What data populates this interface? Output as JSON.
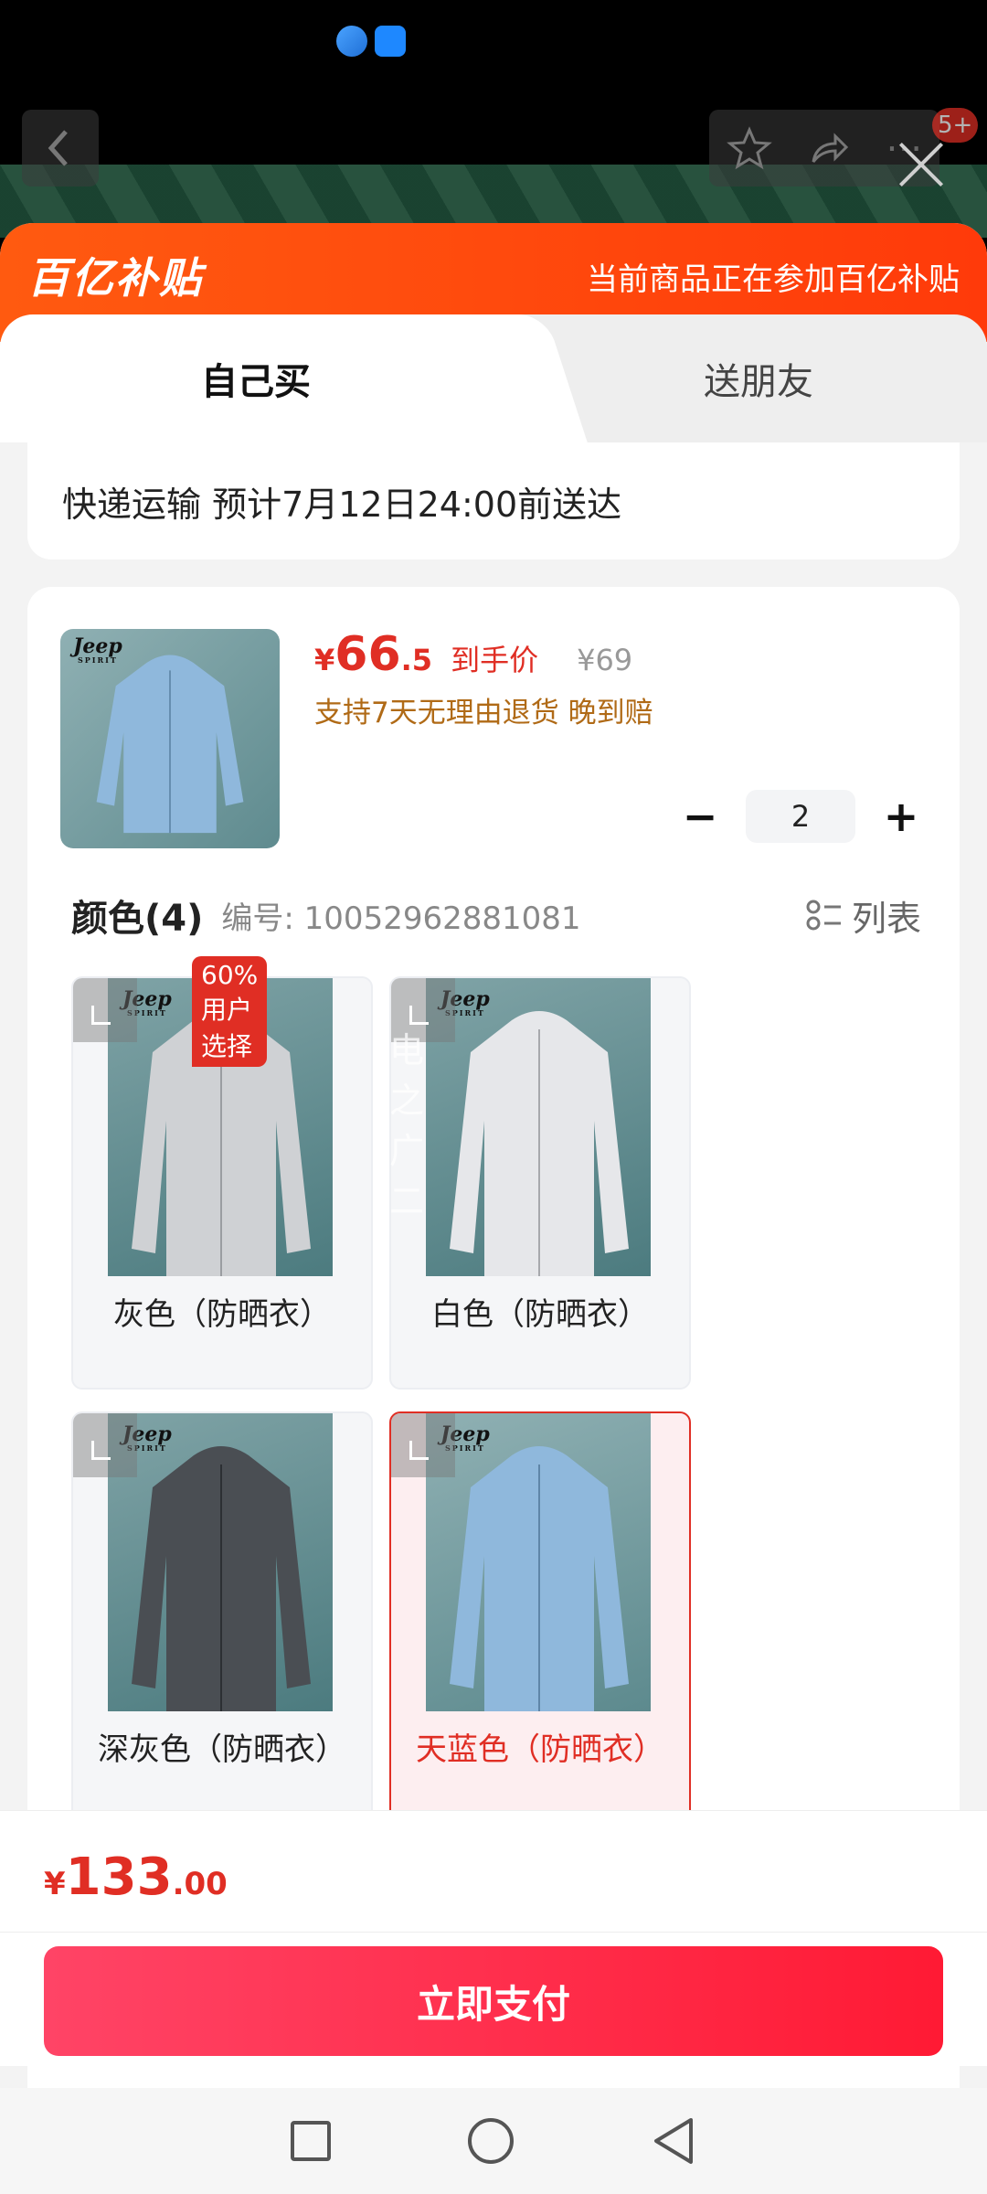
{
  "background": {
    "badge_count": "5+"
  },
  "promo": {
    "logo": "百亿补贴",
    "text": "当前商品正在参加百亿补贴"
  },
  "tabs": {
    "self": "自己买",
    "friend": "送朋友"
  },
  "delivery": "快递运输 预计7月12日24:00前送达",
  "product": {
    "price_symbol": "¥",
    "price_int": "66",
    "price_dec": ".5",
    "price_tag": "到手价",
    "original_price": "¥69",
    "service": "支持7天无理由退货  晚到赔",
    "quantity": "2",
    "brand": "Jeep",
    "brand_sub": "SPIRIT"
  },
  "spec": {
    "title": "颜色(4)",
    "code_label": "编号: 10052962881081",
    "list_label": "列表",
    "options": [
      {
        "label": "灰色（防晒衣）",
        "badge": "60%用户选择",
        "color": "#cfd1d4"
      },
      {
        "label": "白色（防晒衣）",
        "color": "#e6e7ea"
      },
      {
        "label": "深灰色（防晒衣）",
        "color": "#4a4e53"
      },
      {
        "label": "天蓝色（防晒衣）",
        "color": "#8fb8dc",
        "selected": true
      }
    ],
    "watermark": "电之广二"
  },
  "footer": {
    "total_symbol": "¥",
    "total_int": "133",
    "total_dec": ".00",
    "pay_label": "立即支付"
  },
  "colors": {
    "accent": "#e02e24",
    "promo": "#ff4a12",
    "pay": "#ff2a40"
  }
}
